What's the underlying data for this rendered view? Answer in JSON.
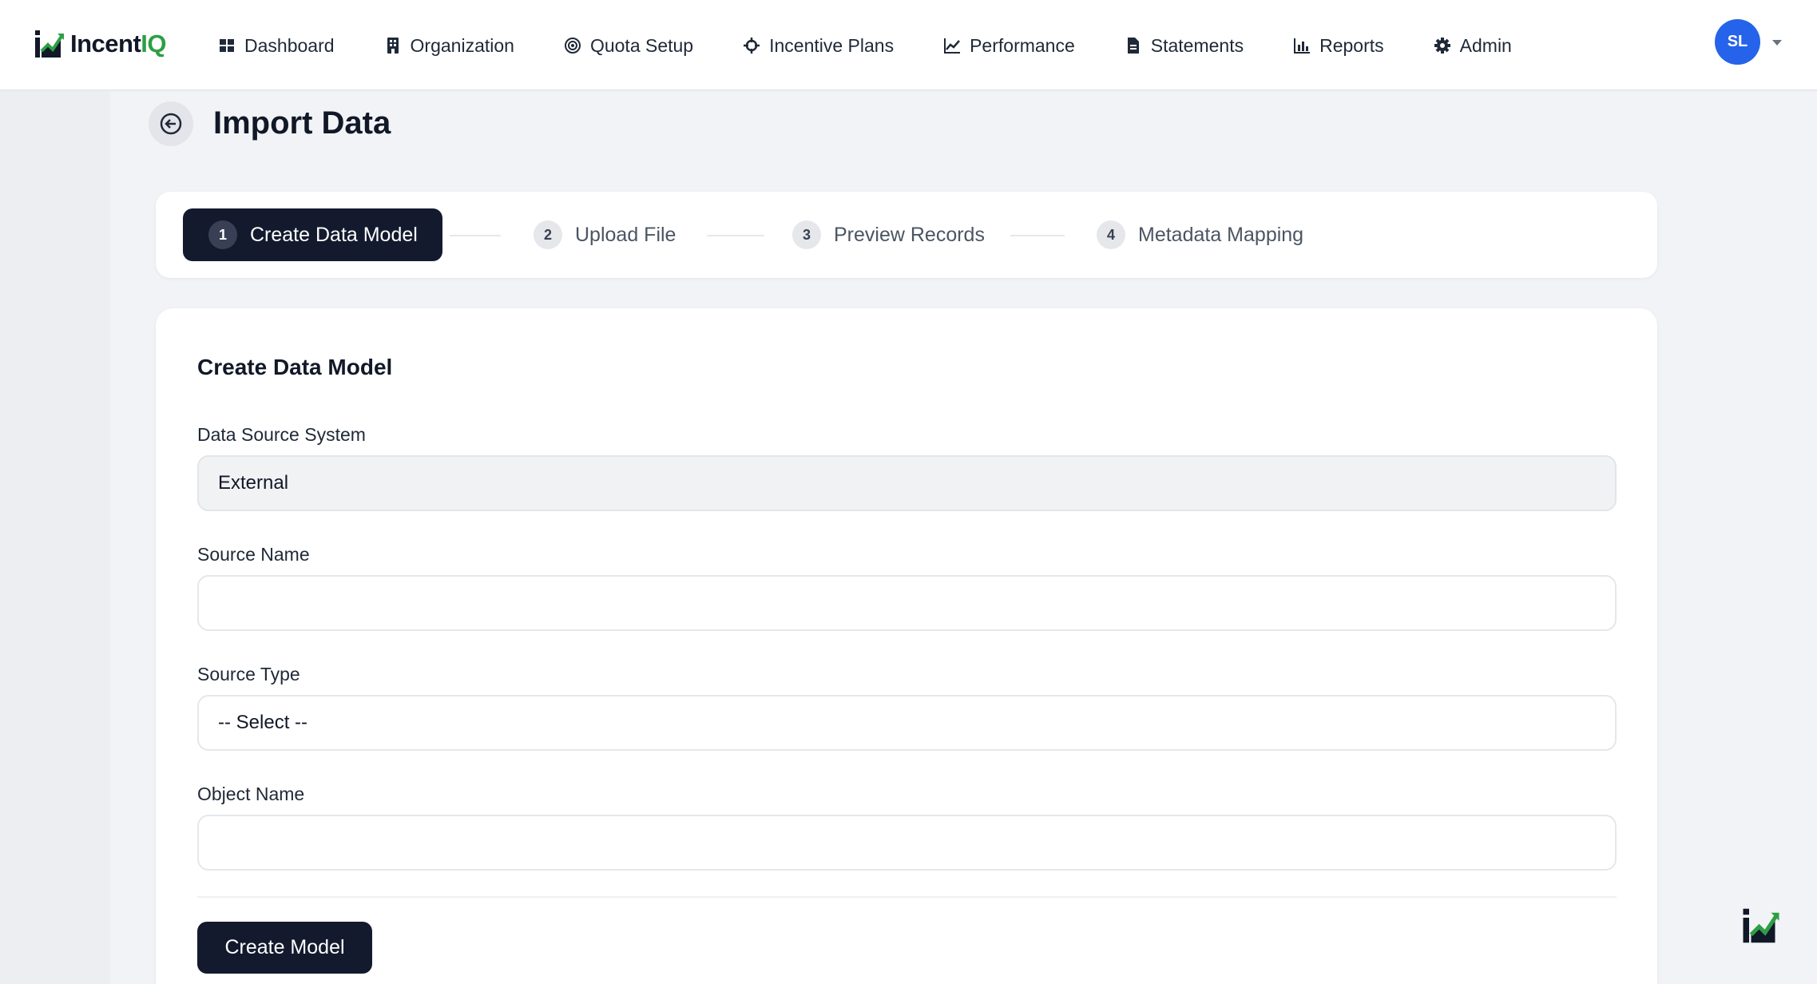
{
  "brand": {
    "name_part1": "Incent",
    "name_part2": "IQ",
    "accent_color": "#2e9e46"
  },
  "nav": {
    "items": [
      {
        "label": "Dashboard",
        "icon": "grid-icon"
      },
      {
        "label": "Organization",
        "icon": "building-icon"
      },
      {
        "label": "Quota Setup",
        "icon": "target-icon"
      },
      {
        "label": "Incentive Plans",
        "icon": "crosshair-icon"
      },
      {
        "label": "Performance",
        "icon": "trend-line-icon"
      },
      {
        "label": "Statements",
        "icon": "document-icon"
      },
      {
        "label": "Reports",
        "icon": "bar-chart-icon"
      },
      {
        "label": "Admin",
        "icon": "gear-icon"
      }
    ]
  },
  "user": {
    "initials": "SL",
    "avatar_color": "#2563eb"
  },
  "page": {
    "title": "Import Data"
  },
  "stepper": {
    "steps": [
      {
        "number": "1",
        "label": "Create Data Model",
        "active": true
      },
      {
        "number": "2",
        "label": "Upload File",
        "active": false
      },
      {
        "number": "3",
        "label": "Preview Records",
        "active": false
      },
      {
        "number": "4",
        "label": "Metadata Mapping",
        "active": false
      }
    ]
  },
  "form": {
    "title": "Create Data Model",
    "data_source_system": {
      "label": "Data Source System",
      "value": "External"
    },
    "source_name": {
      "label": "Source Name",
      "value": ""
    },
    "source_type": {
      "label": "Source Type",
      "value": "-- Select --"
    },
    "object_name": {
      "label": "Object Name",
      "value": ""
    },
    "submit_label": "Create Model"
  }
}
